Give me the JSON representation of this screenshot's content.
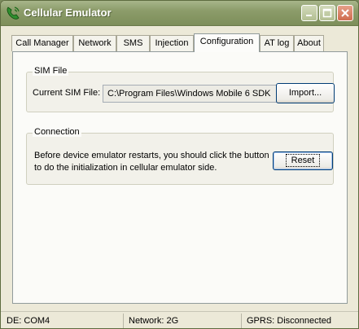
{
  "window": {
    "title": "Cellular Emulator"
  },
  "tabs": [
    {
      "label": "Call Manager"
    },
    {
      "label": "Network"
    },
    {
      "label": "SMS"
    },
    {
      "label": "Injection"
    },
    {
      "label": "Configuration"
    },
    {
      "label": "AT log"
    },
    {
      "label": "About"
    }
  ],
  "active_tab": "Configuration",
  "sim_file": {
    "group_label": "SIM File",
    "current_label": "Current SIM File:",
    "path_value": "C:\\Program Files\\Windows Mobile 6 SDK",
    "import_label": "Import..."
  },
  "connection": {
    "group_label": "Connection",
    "description_line1": "Before device emulator restarts, you should click the button",
    "description_line2": "to do the initialization in cellular emulator side.",
    "reset_label": "Reset"
  },
  "status": {
    "de": "DE: COM4",
    "network": "Network: 2G",
    "gprs": "GPRS: Disconnected"
  },
  "icons": {
    "app": "phone-icon",
    "minimize": "minimize-icon",
    "maximize": "maximize-icon",
    "close": "close-icon"
  }
}
